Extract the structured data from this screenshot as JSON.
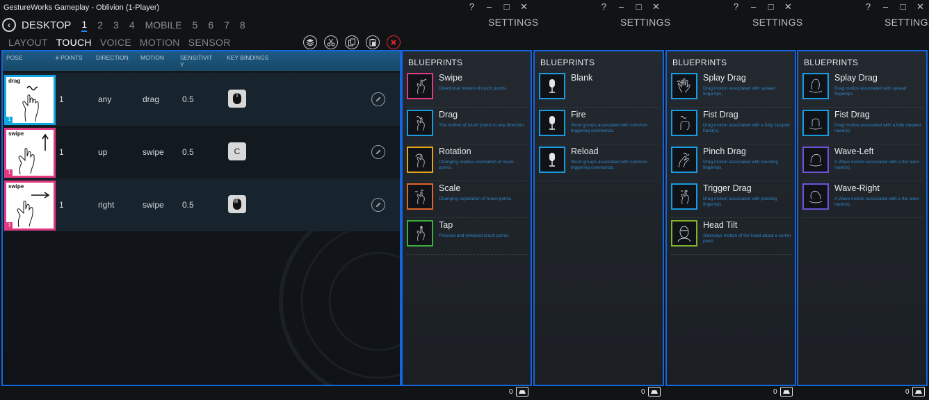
{
  "window": {
    "title": "GestureWorks Gameplay - Oblivion (1-Player)",
    "controls": [
      "?",
      "–",
      "□",
      "✕"
    ],
    "settings_label": "SETTINGS"
  },
  "modebar": {
    "device": "DESKTOP",
    "numbers_a": [
      "1",
      "2",
      "3",
      "4"
    ],
    "mobile": "MOBILE",
    "numbers_b": [
      "5",
      "6",
      "7",
      "8"
    ]
  },
  "tabs": [
    "LAYOUT",
    "TOUCH",
    "VOICE",
    "MOTION",
    "SENSOR"
  ],
  "table": {
    "headers": [
      "POSE",
      "# POINTS",
      "DIRECTION",
      "MOTION",
      "SENSITIVIT Y",
      "KEY BINDINGS"
    ],
    "rows": [
      {
        "pose": "drag",
        "badge": "1",
        "points": "1",
        "direction": "any",
        "motion": "drag",
        "sensitivity": "0.5",
        "key": "mouse-icon",
        "key_text": ""
      },
      {
        "pose": "swipe",
        "badge": "1",
        "points": "1",
        "direction": "up",
        "motion": "swipe",
        "sensitivity": "0.5",
        "key": "letter-key",
        "key_text": "C"
      },
      {
        "pose": "swipe",
        "badge": "1",
        "points": "1",
        "direction": "right",
        "motion": "swipe",
        "sensitivity": "0.5",
        "key": "mouse-icon",
        "key_text": ""
      }
    ]
  },
  "blueprints_title": "BLUEPRINTS",
  "panels": [
    {
      "items": [
        {
          "name": "Swipe",
          "desc": "Directional motion of touch points.",
          "color": "#e23a82"
        },
        {
          "name": "Drag",
          "desc": "The motion of touch points in any direction.",
          "color": "#1a9be0"
        },
        {
          "name": "Rotation",
          "desc": "Changing relative orientation of touch points.",
          "color": "#e6a21a"
        },
        {
          "name": "Scale",
          "desc": "Changing separation of touch points.",
          "color": "#e2642a"
        },
        {
          "name": "Tap",
          "desc": "Pressed and released touch points.",
          "color": "#3cae3c"
        }
      ]
    },
    {
      "items": [
        {
          "name": "Blank",
          "desc": "",
          "color": "#1a9be0"
        },
        {
          "name": "Fire",
          "desc": "Word groups associated with common triggering commands.",
          "color": "#1a9be0"
        },
        {
          "name": "Reload",
          "desc": "Word groups associated with common triggering commands.",
          "color": "#1a9be0"
        }
      ]
    },
    {
      "items": [
        {
          "name": "Splay Drag",
          "desc": "Drag motion associated with spread fingertips.",
          "color": "#1a9be0"
        },
        {
          "name": "Fist Drag",
          "desc": "Drag motion associated with a fully clasped hand(s).",
          "color": "#1a9be0"
        },
        {
          "name": "Pinch Drag",
          "desc": "Drag motion associated with touching fingertips.",
          "color": "#1a9be0"
        },
        {
          "name": "Trigger Drag",
          "desc": "Drag motion associated with pointing fingertips.",
          "color": "#1a9be0"
        },
        {
          "name": "Head Tilt",
          "desc": "Sideways motion of the head about a center point.",
          "color": "#7fb02e"
        }
      ]
    },
    {
      "items": [
        {
          "name": "Splay Drag",
          "desc": "Drag motion associated with spread fingertips.",
          "color": "#1a9be0"
        },
        {
          "name": "Fist Drag",
          "desc": "Drag motion associated with a fully clasped hand(s).",
          "color": "#1a9be0"
        },
        {
          "name": "Wave-Left",
          "desc": "A Wave motion associated with a flat open hand(s).",
          "color": "#6a54d6"
        },
        {
          "name": "Wave-Right",
          "desc": "A Wave motion associated with a flat open hand(s).",
          "color": "#6a54d6"
        }
      ]
    }
  ],
  "footer_count": "0"
}
